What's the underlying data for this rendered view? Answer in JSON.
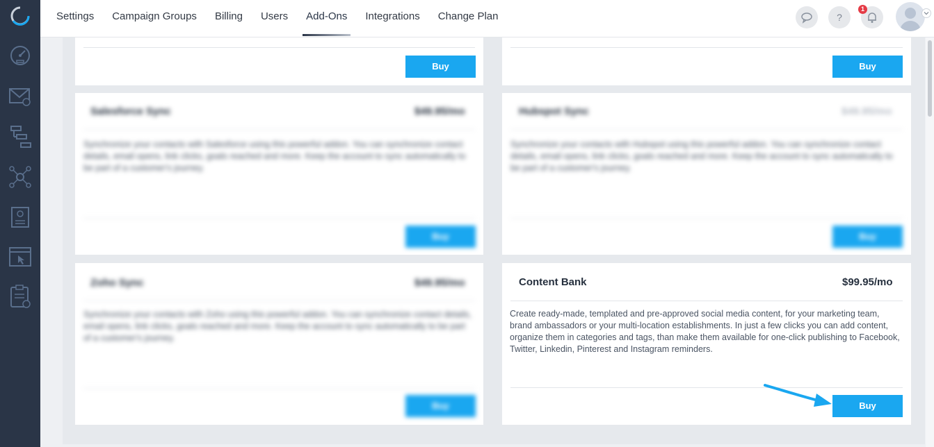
{
  "nav": {
    "items": [
      "Settings",
      "Campaign Groups",
      "Billing",
      "Users",
      "Add-Ons",
      "Integrations",
      "Change Plan"
    ],
    "active": "Add-Ons"
  },
  "header": {
    "notification_count": "1",
    "help_symbol": "?"
  },
  "sidebar_icons": [
    "dashboard-icon",
    "email-icon",
    "workflow-icon",
    "network-icon",
    "contact-card-icon",
    "browser-cursor-icon",
    "clipboard-icon"
  ],
  "cards": {
    "top_left": {
      "buy_label": "Buy"
    },
    "top_right": {
      "buy_label": "Buy"
    },
    "salesforce": {
      "title": "Salesforce Sync",
      "price": "$49.95/mo",
      "description": "Synchronize your contacts with Salesforce using this powerful addon. You can synchronize contact details, email opens, link clicks, goals reached and more. Keep the account to sync automatically to be part of a customer's journey.",
      "buy_label": "Buy"
    },
    "hubspot": {
      "title": "Hubspot Sync",
      "price": "$49.95/mo",
      "description": "Synchronize your contacts with Hubspot using this powerful addon. You can synchronize contact details, email opens, link clicks, goals reached and more. Keep the account to sync automatically to be part of a customer's journey.",
      "buy_label": "Buy"
    },
    "zoho": {
      "title": "Zoho Sync",
      "price": "$49.95/mo",
      "description": "Synchronize your contacts with Zoho using this powerful addon. You can synchronize contact details, email opens, link clicks, goals reached and more. Keep the account to sync automatically to be part of a customer's journey.",
      "buy_label": "Buy"
    },
    "content_bank": {
      "title": "Content Bank",
      "price": "$99.95/mo",
      "description": "Create ready-made, templated and pre-approved social media content, for your marketing team, brand ambassadors or your multi-location establishments. In just a few clicks you can add content, organize them in categories and tags, than make them available for one-click publishing to Facebook, Twitter, Linkedin, Pinterest and Instagram reminders.",
      "buy_label": "Buy"
    }
  },
  "colors": {
    "sidebar": "#2a3547",
    "buy_button": "#1aa7f0",
    "arrow": "#1aa7f0",
    "badge": "#e53b46"
  }
}
